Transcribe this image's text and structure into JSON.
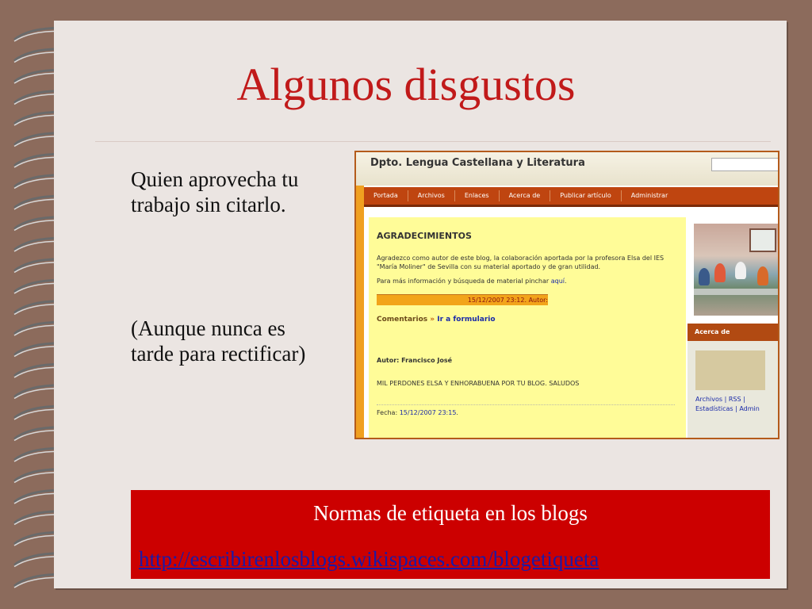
{
  "slide": {
    "title": "Algunos disgustos",
    "text1_line1": "Quien aprovecha tu",
    "text1_line2": "trabajo sin citarlo.",
    "text2_line1": "(Aunque nunca es",
    "text2_line2": "tarde para rectificar)",
    "box_title": "Normas de etiqueta en los blogs",
    "box_link": "http://escribirenlosblogs.wikispaces.com/blogetiqueta"
  },
  "blog": {
    "title": "Dpto. Lengua Castellana y Literatura",
    "nav": [
      "Portada",
      "Archivos",
      "Enlaces",
      "Acerca de",
      "Publicar artículo",
      "Administrar"
    ],
    "post": {
      "heading": "AGRADECIMIENTOS",
      "p1": "Agradezco como autor de este blog, la colaboración aportada por la profesora Elsa del IES \"María Moliner\" de Sevilla con su material aportado y de gran utilidad.",
      "p2": "Para más información y búsqueda de material pinchar",
      "p2_link": "aquí",
      "date": "15/12/2007 23:12. Autor:",
      "comments_label": "Comentarios",
      "comments_arrow": "»",
      "comments_link": "Ir a formulario",
      "author": "Autor: Francisco José",
      "message": "MIL PERDONES ELSA Y ENHORABUENA POR TU BLOG. SALUDOS",
      "fecha_label": "Fecha:",
      "fecha_value": "15/12/2007 23:15"
    },
    "about": {
      "title": "Acerca de",
      "archivos": "Archivos",
      "rss": "RSS",
      "estadisticas": "Estadísticas",
      "admin": "Admin"
    }
  },
  "colors": {
    "title": "#c11a1a",
    "background": "#8c6b5c",
    "paper": "#ebe5e2",
    "box": "#cc0000",
    "box_link": "#1a1aa8"
  }
}
